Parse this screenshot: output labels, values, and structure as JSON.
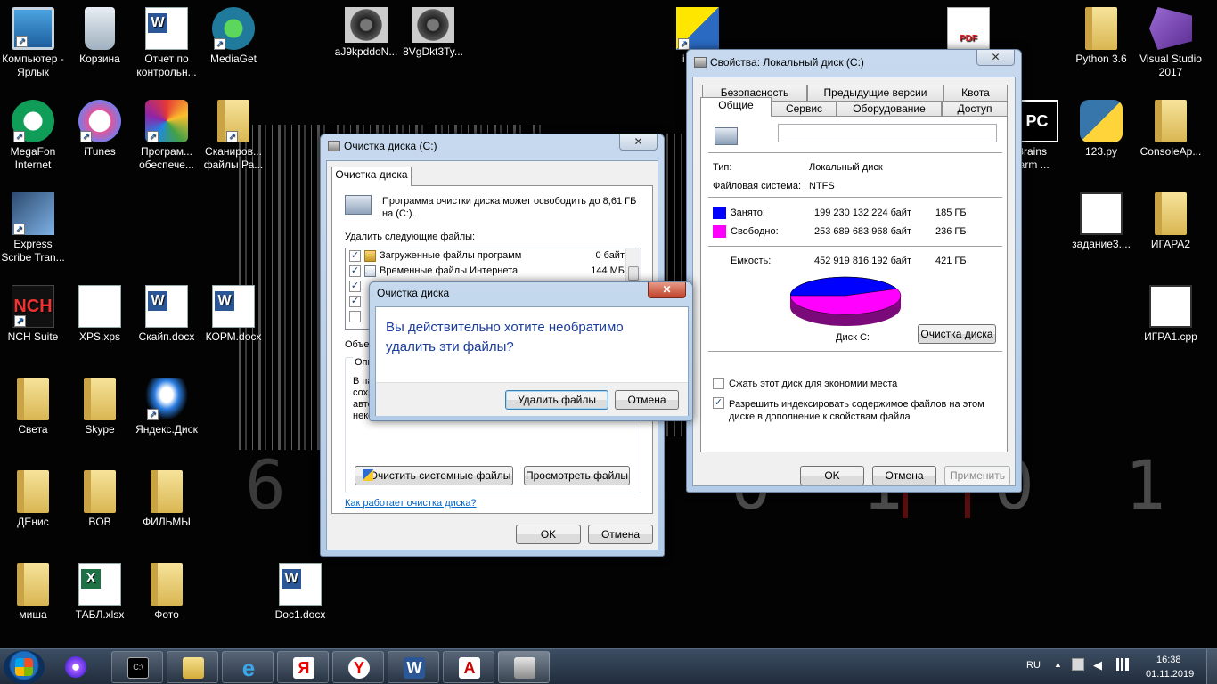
{
  "desktop": {
    "icons": [
      {
        "name": "computer",
        "label": "Компьютер - Ярлык",
        "icon": "computer-icon"
      },
      {
        "name": "recycle-bin",
        "label": "Корзина",
        "icon": "recycle-bin-icon"
      },
      {
        "name": "report",
        "label": "Отчет по контрольн...",
        "icon": "word-doc-icon"
      },
      {
        "name": "mediaget",
        "label": "MediaGet",
        "icon": "mediaget-icon"
      },
      {
        "name": "img1",
        "label": "aJ9kpddoN...",
        "icon": "tire-image-icon"
      },
      {
        "name": "img2",
        "label": "8VgDkt3Ty...",
        "icon": "wheels-image-icon"
      },
      {
        "name": "partial-i",
        "label": "i",
        "icon": "shield-shortcut-icon"
      },
      {
        "name": "pdf",
        "label": "",
        "icon": "pdf-icon"
      },
      {
        "name": "python",
        "label": "Python 3.6",
        "icon": "folder-icon"
      },
      {
        "name": "vs",
        "label": "Visual Studio 2017",
        "icon": "visual-studio-icon"
      },
      {
        "name": "megafon",
        "label": "MegaFon Internet",
        "icon": "megafon-icon"
      },
      {
        "name": "itunes",
        "label": "iTunes",
        "icon": "itunes-icon"
      },
      {
        "name": "software",
        "label": "Програм... обеспече...",
        "icon": "software-icon"
      },
      {
        "name": "scans",
        "label": "Сканиров... файлы Ра...",
        "icon": "folder-icon"
      },
      {
        "name": "jetbrains",
        "label": "etBrains Charm ...",
        "icon": "pycharm-icon"
      },
      {
        "name": "py123",
        "label": "123.py",
        "icon": "python-file-icon"
      },
      {
        "name": "consoleapp",
        "label": "ConsoleAp...",
        "icon": "folder-icon"
      },
      {
        "name": "express",
        "label": "Express Scribe Tran...",
        "icon": "express-scribe-icon"
      },
      {
        "name": "zadanie",
        "label": "задание3....",
        "icon": "cpp-file-icon"
      },
      {
        "name": "igara2",
        "label": "ИГАРА2",
        "icon": "folder-icon"
      },
      {
        "name": "nch",
        "label": "NCH Suite",
        "icon": "nch-icon"
      },
      {
        "name": "xps",
        "label": "XPS.xps",
        "icon": "xps-doc-icon"
      },
      {
        "name": "skype-doc",
        "label": "Скайп.docx",
        "icon": "word-doc-icon"
      },
      {
        "name": "korm",
        "label": "КОРМ.docx",
        "icon": "word-doc-icon"
      },
      {
        "name": "igra1",
        "label": "ИГРА1.cpp",
        "icon": "cpp-file-icon"
      },
      {
        "name": "sveta",
        "label": "Света",
        "icon": "folder-icon"
      },
      {
        "name": "skype",
        "label": "Skype",
        "icon": "folder-icon"
      },
      {
        "name": "yadisk",
        "label": "Яндекс.Диск",
        "icon": "yandex-disk-icon"
      },
      {
        "name": "denis",
        "label": "ДЕнис",
        "icon": "folder-icon"
      },
      {
        "name": "bob",
        "label": "BOB",
        "icon": "folder-icon"
      },
      {
        "name": "films",
        "label": "ФИЛЬМЫ",
        "icon": "folder-icon"
      },
      {
        "name": "misha",
        "label": "миша",
        "icon": "folder-icon"
      },
      {
        "name": "tabl",
        "label": "ТАБЛ.xlsx",
        "icon": "excel-doc-icon"
      },
      {
        "name": "photo",
        "label": "Фото",
        "icon": "folder-icon"
      },
      {
        "name": "doc1",
        "label": "Doc1.docx",
        "icon": "word-doc-icon"
      }
    ],
    "wallpaper_digits_left": "6 4",
    "wallpaper_digits_right": "0 1 0 1"
  },
  "cleanup": {
    "title": "Очистка диска  (C:)",
    "tab": "Очистка диска",
    "intro": "Программа очистки диска может освободить до 8,61 ГБ",
    "intro2": "на  (C:).",
    "list_label": "Удалить следующие файлы:",
    "files": [
      {
        "name": "Загруженные файлы программ",
        "size": "0 байт",
        "checked": "✓"
      },
      {
        "name": "Временные файлы Интернета",
        "size": "144 МБ",
        "checked": "✓"
      }
    ],
    "desc_label": "Объе",
    "desc_group": "Опи",
    "desc_text": [
      "В па",
      "сохр",
      "авто",
      "некс"
    ],
    "clean_system_button": "Очистить системные файлы",
    "view_files_button": "Просмотреть файлы",
    "how_link": "Как работает очистка диска?",
    "ok": "OK",
    "cancel": "Отмена"
  },
  "confirm": {
    "title": "Очистка диска",
    "message": "Вы действительно хотите необратимо удалить эти файлы?",
    "delete_button": "Удалить файлы",
    "cancel_button": "Отмена"
  },
  "props": {
    "title": "Свойства: Локальный диск (C:)",
    "tabs_row1": [
      "Безопасность",
      "Предыдущие версии",
      "Квота"
    ],
    "tabs_row2": [
      "Общие",
      "Сервис",
      "Оборудование",
      "Доступ"
    ],
    "label_value": "",
    "type_label": "Тип:",
    "type_value": "Локальный диск",
    "fs_label": "Файловая система:",
    "fs_value": "NTFS",
    "used_label": "Занято:",
    "used_bytes": "199 230 132 224 байт",
    "used_gb": "185 ГБ",
    "free_label": "Свободно:",
    "free_bytes": "253 689 683 968 байт",
    "free_gb": "236 ГБ",
    "cap_label": "Емкость:",
    "cap_bytes": "452 919 816 192 байт",
    "cap_gb": "421 ГБ",
    "disk_label": "Диск С:",
    "cleanup_button": "Очистка диска",
    "compress_label": "Сжать этот диск для экономии места",
    "index_label": "Разрешить индексировать содержимое файлов на этом диске в дополнение к свойствам файла",
    "index_checked": "✓",
    "ok": "OK",
    "cancel": "Отмена",
    "apply": "Применить",
    "colors": {
      "used": "#0000ff",
      "free": "#ff00ff"
    },
    "used_fraction": 0.44
  },
  "taskbar": {
    "lang": "RU",
    "time": "16:38",
    "date": "01.11.2019",
    "apps": [
      "alice-icon",
      "cmd-icon",
      "explorer-icon",
      "ie-icon",
      "yandex-icon",
      "yandex-browser-icon",
      "word-icon",
      "acrobat-icon",
      "disk-cleanup-icon"
    ]
  },
  "close_symbol": "✕"
}
